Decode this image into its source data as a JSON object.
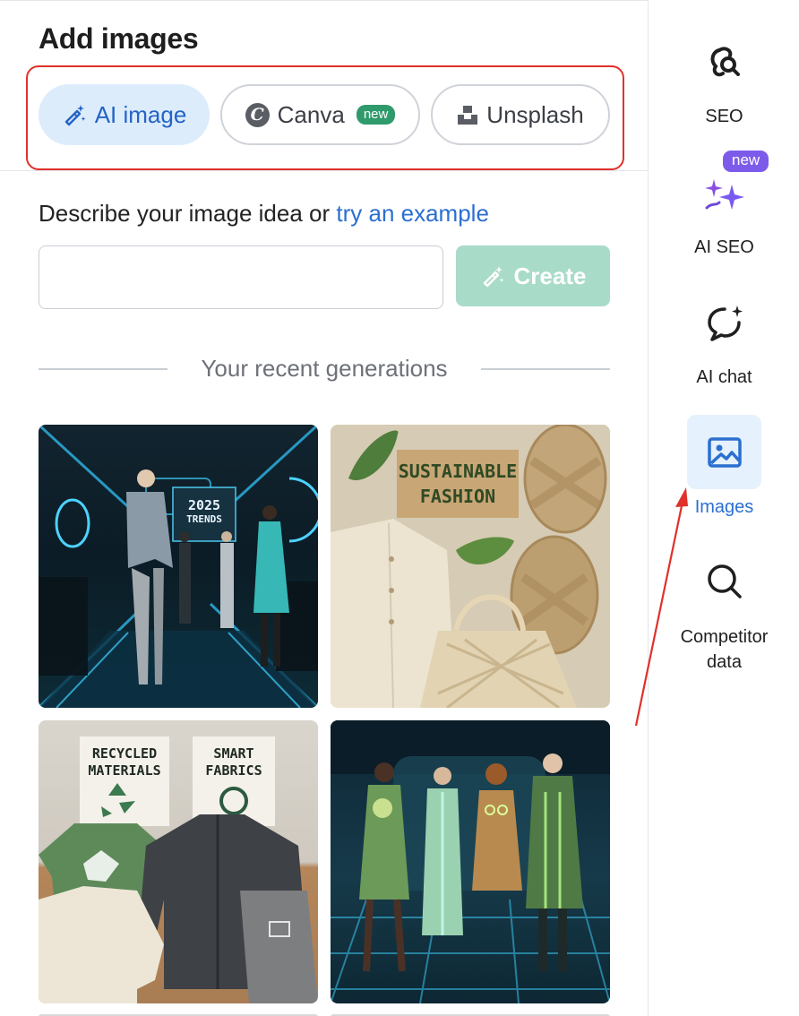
{
  "panel": {
    "title": "Add images",
    "tabs": [
      {
        "label": "AI image",
        "active": true
      },
      {
        "label": "Canva",
        "badge": "new"
      },
      {
        "label": "Unsplash"
      }
    ],
    "prompt_text": "Describe your image idea or ",
    "prompt_link": "try an example",
    "input_value": "",
    "input_placeholder": "",
    "create_label": "Create",
    "recent_label": "Your recent generations",
    "images": [
      {
        "text": [
          "2025",
          "TRENDS"
        ]
      },
      {
        "text": [
          "SUSTAINABLE",
          "FASHION"
        ]
      },
      {
        "text": [
          "RECYCLED",
          "MATERIALS",
          "SMART",
          "FABRICS"
        ]
      },
      {
        "text": []
      }
    ]
  },
  "sidebar": {
    "items": [
      {
        "label": "SEO",
        "icon": "seo-icon"
      },
      {
        "label": "AI SEO",
        "icon": "sparkles-icon",
        "badge": "new"
      },
      {
        "label": "AI chat",
        "icon": "chat-bubble-icon"
      },
      {
        "label": "Images",
        "icon": "image-icon",
        "active": true
      },
      {
        "label_line1": "Competitor",
        "label_line2": "data",
        "icon": "search-icon"
      }
    ]
  },
  "colors": {
    "accent_blue": "#2b6fd0",
    "ai_tab_bg": "#dcecfb",
    "create_button_bg": "#a9dbc9",
    "new_badge_green": "#2f9a6b",
    "new_badge_purple": "#7d5bea",
    "highlight_red": "#e0312b"
  }
}
